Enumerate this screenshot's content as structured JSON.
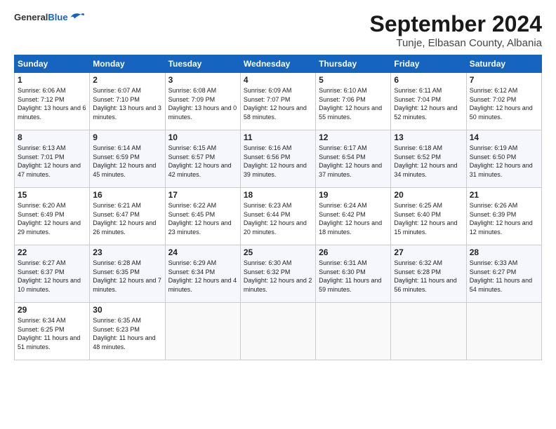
{
  "header": {
    "logo_general": "General",
    "logo_blue": "Blue",
    "month_title": "September 2024",
    "location": "Tunje, Elbasan County, Albania"
  },
  "weekdays": [
    "Sunday",
    "Monday",
    "Tuesday",
    "Wednesday",
    "Thursday",
    "Friday",
    "Saturday"
  ],
  "weeks": [
    [
      {
        "day": "1",
        "sunrise": "Sunrise: 6:06 AM",
        "sunset": "Sunset: 7:12 PM",
        "daylight": "Daylight: 13 hours and 6 minutes."
      },
      {
        "day": "2",
        "sunrise": "Sunrise: 6:07 AM",
        "sunset": "Sunset: 7:10 PM",
        "daylight": "Daylight: 13 hours and 3 minutes."
      },
      {
        "day": "3",
        "sunrise": "Sunrise: 6:08 AM",
        "sunset": "Sunset: 7:09 PM",
        "daylight": "Daylight: 13 hours and 0 minutes."
      },
      {
        "day": "4",
        "sunrise": "Sunrise: 6:09 AM",
        "sunset": "Sunset: 7:07 PM",
        "daylight": "Daylight: 12 hours and 58 minutes."
      },
      {
        "day": "5",
        "sunrise": "Sunrise: 6:10 AM",
        "sunset": "Sunset: 7:06 PM",
        "daylight": "Daylight: 12 hours and 55 minutes."
      },
      {
        "day": "6",
        "sunrise": "Sunrise: 6:11 AM",
        "sunset": "Sunset: 7:04 PM",
        "daylight": "Daylight: 12 hours and 52 minutes."
      },
      {
        "day": "7",
        "sunrise": "Sunrise: 6:12 AM",
        "sunset": "Sunset: 7:02 PM",
        "daylight": "Daylight: 12 hours and 50 minutes."
      }
    ],
    [
      {
        "day": "8",
        "sunrise": "Sunrise: 6:13 AM",
        "sunset": "Sunset: 7:01 PM",
        "daylight": "Daylight: 12 hours and 47 minutes."
      },
      {
        "day": "9",
        "sunrise": "Sunrise: 6:14 AM",
        "sunset": "Sunset: 6:59 PM",
        "daylight": "Daylight: 12 hours and 45 minutes."
      },
      {
        "day": "10",
        "sunrise": "Sunrise: 6:15 AM",
        "sunset": "Sunset: 6:57 PM",
        "daylight": "Daylight: 12 hours and 42 minutes."
      },
      {
        "day": "11",
        "sunrise": "Sunrise: 6:16 AM",
        "sunset": "Sunset: 6:56 PM",
        "daylight": "Daylight: 12 hours and 39 minutes."
      },
      {
        "day": "12",
        "sunrise": "Sunrise: 6:17 AM",
        "sunset": "Sunset: 6:54 PM",
        "daylight": "Daylight: 12 hours and 37 minutes."
      },
      {
        "day": "13",
        "sunrise": "Sunrise: 6:18 AM",
        "sunset": "Sunset: 6:52 PM",
        "daylight": "Daylight: 12 hours and 34 minutes."
      },
      {
        "day": "14",
        "sunrise": "Sunrise: 6:19 AM",
        "sunset": "Sunset: 6:50 PM",
        "daylight": "Daylight: 12 hours and 31 minutes."
      }
    ],
    [
      {
        "day": "15",
        "sunrise": "Sunrise: 6:20 AM",
        "sunset": "Sunset: 6:49 PM",
        "daylight": "Daylight: 12 hours and 29 minutes."
      },
      {
        "day": "16",
        "sunrise": "Sunrise: 6:21 AM",
        "sunset": "Sunset: 6:47 PM",
        "daylight": "Daylight: 12 hours and 26 minutes."
      },
      {
        "day": "17",
        "sunrise": "Sunrise: 6:22 AM",
        "sunset": "Sunset: 6:45 PM",
        "daylight": "Daylight: 12 hours and 23 minutes."
      },
      {
        "day": "18",
        "sunrise": "Sunrise: 6:23 AM",
        "sunset": "Sunset: 6:44 PM",
        "daylight": "Daylight: 12 hours and 20 minutes."
      },
      {
        "day": "19",
        "sunrise": "Sunrise: 6:24 AM",
        "sunset": "Sunset: 6:42 PM",
        "daylight": "Daylight: 12 hours and 18 minutes."
      },
      {
        "day": "20",
        "sunrise": "Sunrise: 6:25 AM",
        "sunset": "Sunset: 6:40 PM",
        "daylight": "Daylight: 12 hours and 15 minutes."
      },
      {
        "day": "21",
        "sunrise": "Sunrise: 6:26 AM",
        "sunset": "Sunset: 6:39 PM",
        "daylight": "Daylight: 12 hours and 12 minutes."
      }
    ],
    [
      {
        "day": "22",
        "sunrise": "Sunrise: 6:27 AM",
        "sunset": "Sunset: 6:37 PM",
        "daylight": "Daylight: 12 hours and 10 minutes."
      },
      {
        "day": "23",
        "sunrise": "Sunrise: 6:28 AM",
        "sunset": "Sunset: 6:35 PM",
        "daylight": "Daylight: 12 hours and 7 minutes."
      },
      {
        "day": "24",
        "sunrise": "Sunrise: 6:29 AM",
        "sunset": "Sunset: 6:34 PM",
        "daylight": "Daylight: 12 hours and 4 minutes."
      },
      {
        "day": "25",
        "sunrise": "Sunrise: 6:30 AM",
        "sunset": "Sunset: 6:32 PM",
        "daylight": "Daylight: 12 hours and 2 minutes."
      },
      {
        "day": "26",
        "sunrise": "Sunrise: 6:31 AM",
        "sunset": "Sunset: 6:30 PM",
        "daylight": "Daylight: 11 hours and 59 minutes."
      },
      {
        "day": "27",
        "sunrise": "Sunrise: 6:32 AM",
        "sunset": "Sunset: 6:28 PM",
        "daylight": "Daylight: 11 hours and 56 minutes."
      },
      {
        "day": "28",
        "sunrise": "Sunrise: 6:33 AM",
        "sunset": "Sunset: 6:27 PM",
        "daylight": "Daylight: 11 hours and 54 minutes."
      }
    ],
    [
      {
        "day": "29",
        "sunrise": "Sunrise: 6:34 AM",
        "sunset": "Sunset: 6:25 PM",
        "daylight": "Daylight: 11 hours and 51 minutes."
      },
      {
        "day": "30",
        "sunrise": "Sunrise: 6:35 AM",
        "sunset": "Sunset: 6:23 PM",
        "daylight": "Daylight: 11 hours and 48 minutes."
      },
      null,
      null,
      null,
      null,
      null
    ]
  ]
}
